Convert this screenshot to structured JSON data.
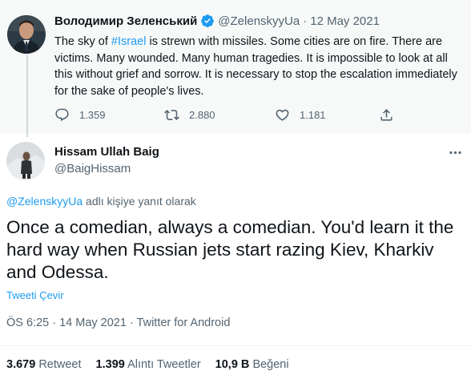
{
  "parent_tweet": {
    "author_name": "Володимир Зеленський",
    "author_handle": "@ZelenskyyUa",
    "separator": "·",
    "date": "12 May 2021",
    "text_before": "The sky of ",
    "hashtag": "#Israel",
    "text_after": " is strewn with missiles. Some cities are on fire. There are victims. Many wounded. Many human tragedies. It is impossible to look at all this without grief and sorrow. It is necessary to stop the escalation immediately for the sake of people's lives.",
    "replies": "1.359",
    "retweets": "2.880",
    "likes": "1.181"
  },
  "main_tweet": {
    "author_name": "Hissam Ullah Baig",
    "author_handle": "@BaigHissam",
    "reply_to_mention": "@ZelenskyyUa",
    "reply_to_suffix": " adlı kişiye yanıt olarak",
    "text": "Once a comedian, always a comedian. You'd learn it the hard way when Russian jets start razing Kiev, Kharkiv and Odessa.",
    "translate_label": "Tweeti Çevir",
    "timestamp": "ÖS 6:25 · 14 May 2021 · Twitter for Android",
    "stats": [
      {
        "value": "3.679",
        "label": "Retweet"
      },
      {
        "value": "1.399",
        "label": "Alıntı Tweetler"
      },
      {
        "value": "10,9 B",
        "label": "Beğeni"
      }
    ]
  },
  "colors": {
    "accent": "#1d9bf0",
    "secondary_text": "#536471",
    "primary_text": "#0f1419",
    "parent_background": "#f7f9f9"
  },
  "icons": [
    "verified-badge-icon",
    "reply-icon",
    "retweet-icon",
    "like-icon",
    "share-icon",
    "more-options-icon"
  ]
}
